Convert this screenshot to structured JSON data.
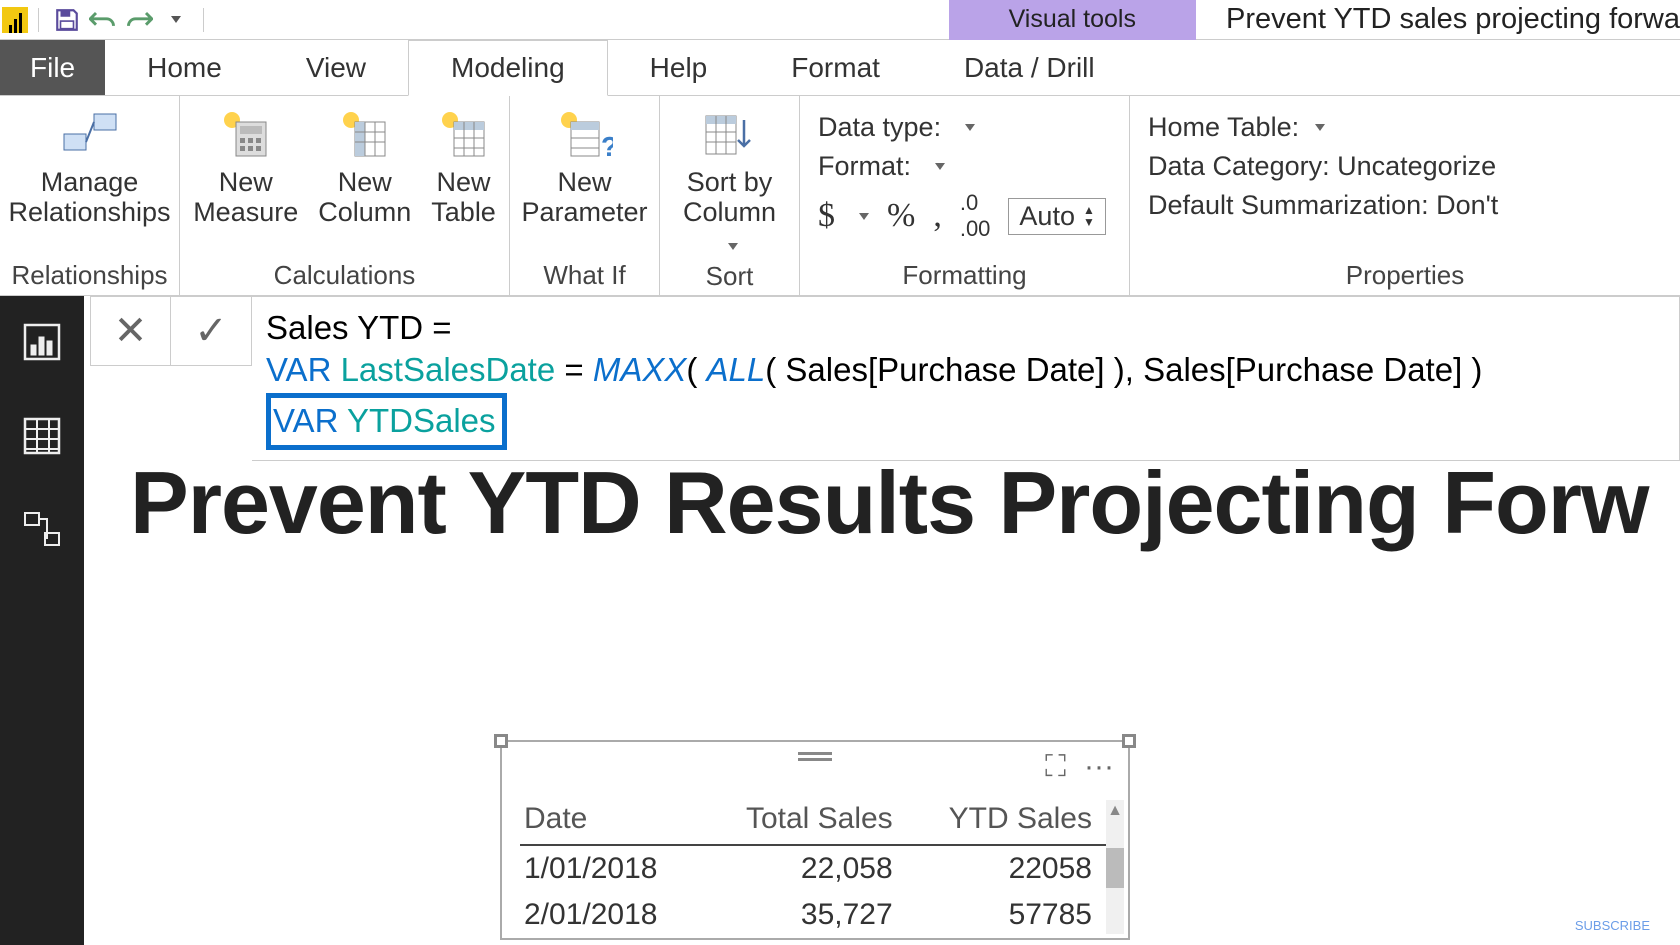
{
  "titlebar": {
    "contextual_tab": "Visual tools",
    "document_title": "Prevent YTD sales projecting forwa"
  },
  "tabs": {
    "file": "File",
    "home": "Home",
    "view": "View",
    "modeling": "Modeling",
    "help": "Help",
    "format": "Format",
    "data_drill": "Data / Drill"
  },
  "ribbon": {
    "relationships": {
      "manage": "Manage\nRelationships",
      "group": "Relationships"
    },
    "calculations": {
      "new_measure": "New\nMeasure",
      "new_column": "New\nColumn",
      "new_table": "New\nTable",
      "group": "Calculations"
    },
    "whatif": {
      "new_parameter": "New\nParameter",
      "group": "What If"
    },
    "sort": {
      "sort_by_column": "Sort by\nColumn",
      "group": "Sort"
    },
    "formatting": {
      "data_type": "Data type:",
      "format": "Format:",
      "currency": "$",
      "percent": "%",
      "thousands": ",",
      "decimal": ".0₀₀",
      "auto": "Auto",
      "group": "Formatting"
    },
    "properties": {
      "home_table": "Home Table:",
      "data_category": "Data Category: Uncategorize",
      "default_summarization": "Default Summarization: Don't",
      "group": "Properties"
    }
  },
  "formula": {
    "line1_prefix": "Sales YTD =",
    "var_kw": "VAR",
    "var1_name": "LastSalesDate",
    "eq": " = ",
    "fn_maxx": "MAXX",
    "fn_all": "ALL",
    "arg1": "( Sales[Purchase Date] ), Sales[Purchase Date] )",
    "var2_name": "YTDSales"
  },
  "canvas": {
    "title": "Prevent YTD Results Projecting Forw"
  },
  "table": {
    "headers": [
      "Date",
      "Total Sales",
      "YTD Sales"
    ],
    "rows": [
      {
        "date": "1/01/2018",
        "total": "22,058",
        "ytd": "22058"
      },
      {
        "date": "2/01/2018",
        "total": "35,727",
        "ytd": "57785"
      }
    ]
  },
  "watermark": "SUBSCRIBE"
}
